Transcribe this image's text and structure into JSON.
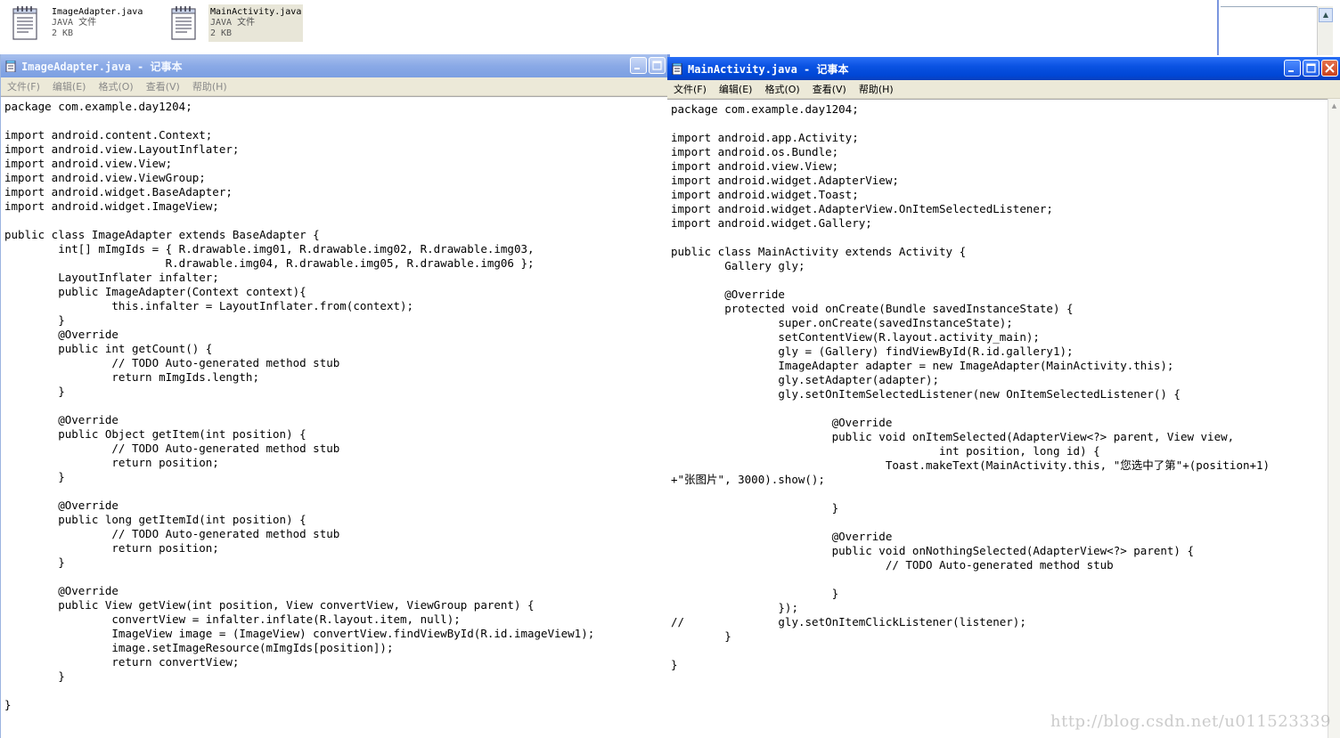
{
  "explorer": {
    "files": [
      {
        "name": "ImageAdapter.java",
        "type": "JAVA 文件",
        "size": "2 KB",
        "selected": false,
        "icon": "notepad-file-icon"
      },
      {
        "name": "MainActivity.java",
        "type": "JAVA 文件",
        "size": "2 KB",
        "selected": true,
        "icon": "notepad-file-icon"
      }
    ]
  },
  "window_left": {
    "title": "ImageAdapter.java - 记事本",
    "active": false,
    "menu": [
      "文件(F)",
      "编辑(E)",
      "格式(O)",
      "查看(V)",
      "帮助(H)"
    ],
    "code": "package com.example.day1204;\n\nimport android.content.Context;\nimport android.view.LayoutInflater;\nimport android.view.View;\nimport android.view.ViewGroup;\nimport android.widget.BaseAdapter;\nimport android.widget.ImageView;\n\npublic class ImageAdapter extends BaseAdapter {\n        int[] mImgIds = { R.drawable.img01, R.drawable.img02, R.drawable.img03,\n                        R.drawable.img04, R.drawable.img05, R.drawable.img06 };\n        LayoutInflater infalter;\n        public ImageAdapter(Context context){\n                this.infalter = LayoutInflater.from(context);\n        }\n        @Override\n        public int getCount() {\n                // TODO Auto-generated method stub\n                return mImgIds.length;\n        }\n\n        @Override\n        public Object getItem(int position) {\n                // TODO Auto-generated method stub\n                return position;\n        }\n\n        @Override\n        public long getItemId(int position) {\n                // TODO Auto-generated method stub\n                return position;\n        }\n\n        @Override\n        public View getView(int position, View convertView, ViewGroup parent) {\n                convertView = infalter.inflate(R.layout.item, null);\n                ImageView image = (ImageView) convertView.findViewById(R.id.imageView1);\n                image.setImageResource(mImgIds[position]);\n                return convertView;\n        }\n\n}"
  },
  "window_right": {
    "title": "MainActivity.java - 记事本",
    "active": true,
    "menu": [
      "文件(F)",
      "编辑(E)",
      "格式(O)",
      "查看(V)",
      "帮助(H)"
    ],
    "code": "package com.example.day1204;\n\nimport android.app.Activity;\nimport android.os.Bundle;\nimport android.view.View;\nimport android.widget.AdapterView;\nimport android.widget.Toast;\nimport android.widget.AdapterView.OnItemSelectedListener;\nimport android.widget.Gallery;\n\npublic class MainActivity extends Activity {\n        Gallery gly;\n\n        @Override\n        protected void onCreate(Bundle savedInstanceState) {\n                super.onCreate(savedInstanceState);\n                setContentView(R.layout.activity_main);\n                gly = (Gallery) findViewById(R.id.gallery1);\n                ImageAdapter adapter = new ImageAdapter(MainActivity.this);\n                gly.setAdapter(adapter);\n                gly.setOnItemSelectedListener(new OnItemSelectedListener() {\n\n                        @Override\n                        public void onItemSelected(AdapterView<?> parent, View view,\n                                        int position, long id) {\n                                Toast.makeText(MainActivity.this, \"您选中了第\"+(position+1)\n+\"张图片\", 3000).show();\n\n                        }\n\n                        @Override\n                        public void onNothingSelected(AdapterView<?> parent) {\n                                // TODO Auto-generated method stub\n\n                        }\n                });\n//              gly.setOnItemClickListener(listener);\n        }\n\n}"
  },
  "watermark": "http://blog.csdn.net/u011523339",
  "colors": {
    "active_titlebar": "#0a52e2",
    "inactive_titlebar": "#8aa9e6",
    "menubar": "#ece9d8",
    "close_button": "#c9421f"
  }
}
